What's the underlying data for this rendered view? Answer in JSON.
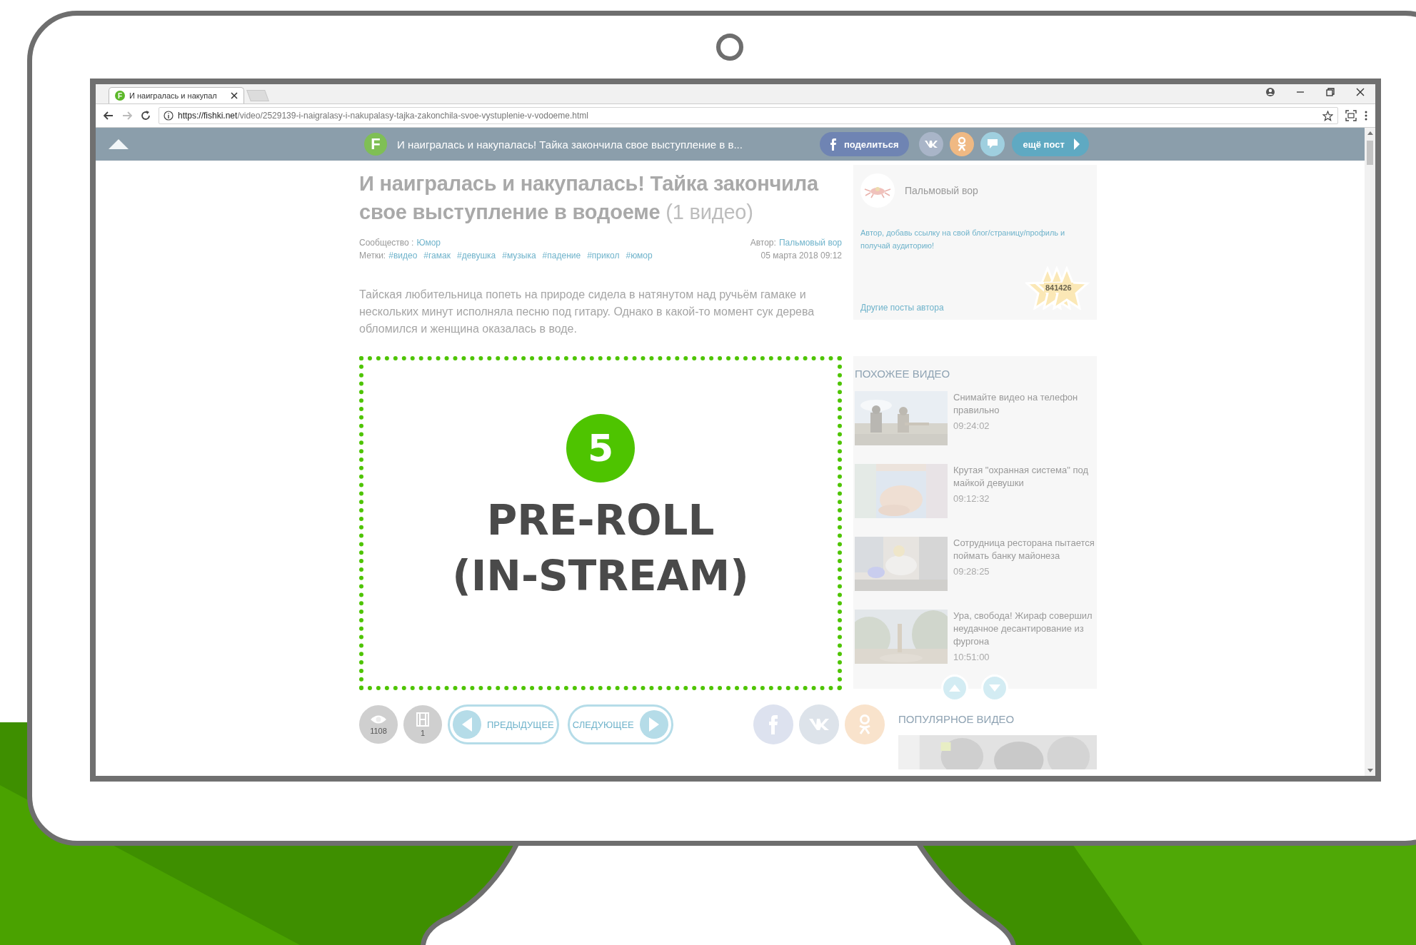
{
  "browser": {
    "favicon": "F",
    "tab_title": "И наигралась и накупал",
    "url_host": "https://fishki.net",
    "url_path": "/video/2529139-i-naigralasy-i-nakupalasy-tajka-zakonchila-svoe-vystuplenie-v-vodoeme.html"
  },
  "site_header": {
    "logo": "F",
    "title": "И наигралась и накупалась! Тайка закончила свое выступление в в...",
    "share_label": "поделиться",
    "more_label": "ещё пост"
  },
  "article": {
    "title": "И наигралась и накупалась! Тайка закончила свое выступление в водоеме",
    "video_count": "(1 видео)",
    "community_label": "Сообщество :",
    "community": "Юмор",
    "author_label": "Автор:",
    "author": "Пальмовый вор",
    "tags_label": "Метки:",
    "tags": [
      "#видео",
      "#гамак",
      "#девушка",
      "#музыка",
      "#падение",
      "#прикол",
      "#юмор"
    ],
    "date": "05 марта 2018 09:12",
    "description": "Тайская любительница попеть на природе сидела в натянутом над ручьём гамаке и нескольких минут исполняла песню под гитару. Однако в какой-то момент сук дерева обломился и женщина оказалась в воде."
  },
  "ad": {
    "number": "5",
    "lines": [
      "PRE-ROLL",
      "(IN-STREAM)"
    ]
  },
  "controls": {
    "views": "1108",
    "videos": "1",
    "previous": "ПРЕДЫДУЩЕЕ",
    "next": "СЛЕДУЮЩЕЕ"
  },
  "author_card": {
    "name": "Пальмовый вор",
    "prompt": "Автор, добавь ссылку на свой блог/страницу/профиль и получай аудиторию!",
    "rating": "841426",
    "other_posts": "Другие посты автора"
  },
  "similar": {
    "heading": "ПОХОЖЕЕ ВИДЕО",
    "videos": [
      {
        "title": "Снимайте видео на телефон правильно",
        "time": "09:24:02"
      },
      {
        "title": "Крутая \"охранная система\" под майкой девушки",
        "time": "09:12:32"
      },
      {
        "title": "Сотрудница ресторана пытается поймать банку майонеза",
        "time": "09:28:25"
      },
      {
        "title": "Ура, свобода! Жираф совершил неудачное десантирование из фургона",
        "time": "10:51:00"
      }
    ]
  },
  "popular": {
    "heading": "ПОПУЛЯРНОЕ ВИДЕО"
  }
}
